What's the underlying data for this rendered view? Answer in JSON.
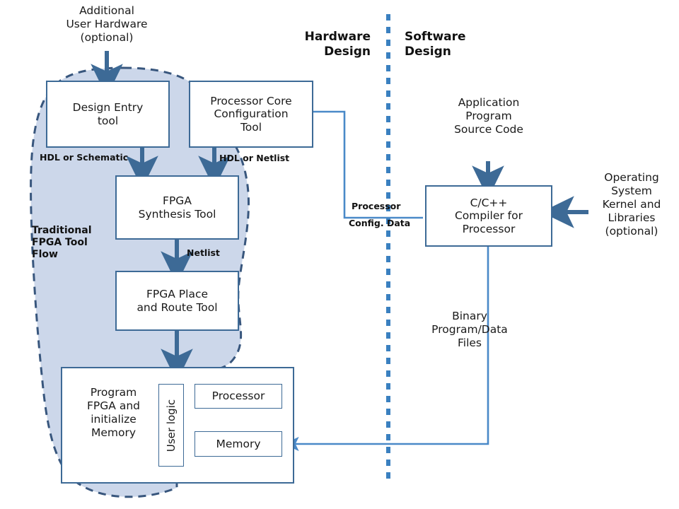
{
  "diagram": {
    "title_hardware": "Hardware\nDesign",
    "sections": {
      "hardware": "Hardware",
      "hardware2": "Design",
      "software": "Software",
      "software2": "Design"
    },
    "colors": {
      "box_border": "#3d6a96",
      "blob_fill": "#ccd7ea",
      "blob_stroke": "#38567d",
      "arrow_dark": "#3d6a96",
      "arrow_light": "#4a89c8",
      "divider": "#3a80c0",
      "text": "#1a1a1a"
    },
    "nodes": [
      {
        "id": "design-entry",
        "label": "Design Entry\ntool"
      },
      {
        "id": "processor-core-cfg",
        "label": "Processor Core\nConfiguration\nTool"
      },
      {
        "id": "fpga-synthesis",
        "label": "FPGA\nSynthesis Tool"
      },
      {
        "id": "fpga-place-route",
        "label": "FPGA Place\nand Route Tool"
      },
      {
        "id": "program-fpga",
        "label": "Program\nFPGA and\ninitialize\nMemory"
      },
      {
        "id": "user-logic",
        "label": "User logic"
      },
      {
        "id": "processor",
        "label": "Processor"
      },
      {
        "id": "memory",
        "label": "Memory"
      },
      {
        "id": "cpp-compiler",
        "label": "C/C++\nCompiler for\nProcessor"
      }
    ],
    "free_texts": [
      {
        "id": "additional-user-hardware",
        "label": "Additional\nUser Hardware\n(optional)"
      },
      {
        "id": "application-program",
        "label": "Application\nProgram\nSource Code"
      },
      {
        "id": "operating-system",
        "label": "Operating\nSystem\nKernel and\nLibraries\n(optional)"
      },
      {
        "id": "binary-program",
        "label": "Binary\nProgram/Data\nFiles"
      }
    ],
    "edge_labels": [
      {
        "id": "hdl-or-schematic",
        "label": "HDL or Schematic"
      },
      {
        "id": "hdl-or-netlist",
        "label": "HDL or Netlist"
      },
      {
        "id": "netlist",
        "label": "Netlist"
      },
      {
        "id": "processor-config-1",
        "label": "Processor"
      },
      {
        "id": "processor-config-2",
        "label": "Config. Data"
      }
    ],
    "blob_label": "Traditional\nFPGA Tool\nFlow"
  }
}
